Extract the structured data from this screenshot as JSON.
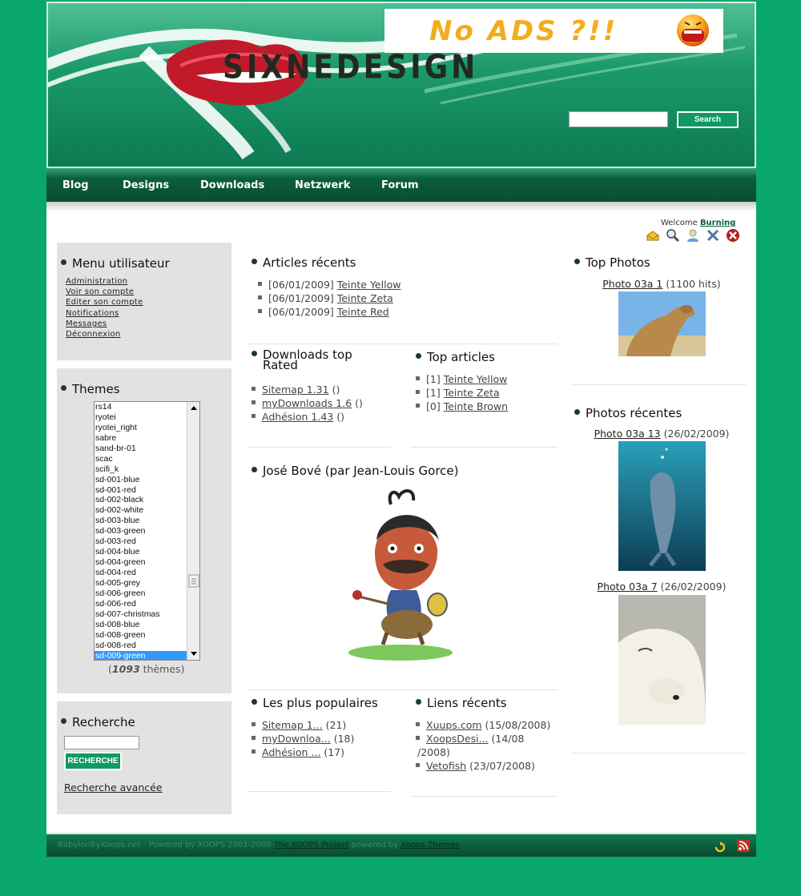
{
  "header": {
    "logo_text": "SIXNEDESIGN",
    "ad_text": "No ADS ?!!",
    "search_placeholder": "",
    "search_button": "Search"
  },
  "nav": {
    "items": [
      "Blog",
      "Designs",
      "Downloads",
      "Netzwerk",
      "Forum"
    ]
  },
  "user": {
    "welcome_label": "Welcome",
    "username": "Burning",
    "icons": [
      "inbox-icon",
      "search-icon",
      "account-icon",
      "tools-icon",
      "logout-icon"
    ]
  },
  "user_menu": {
    "title": "Menu utilisateur",
    "items": [
      "Administration",
      "Voir son compte",
      "Editer son compte",
      "Notifications",
      "Messages",
      "Déconnexion"
    ]
  },
  "themes": {
    "title": "Themes",
    "options": [
      "rs14",
      "ryotei",
      "ryotei_right",
      "sabre",
      "sand-br-01",
      "scac",
      "scifi_k",
      "sd-001-blue",
      "sd-001-red",
      "sd-002-black",
      "sd-002-white",
      "sd-003-blue",
      "sd-003-green",
      "sd-003-red",
      "sd-004-blue",
      "sd-004-green",
      "sd-004-red",
      "sd-005-grey",
      "sd-006-green",
      "sd-006-red",
      "sd-007-christmas",
      "sd-008-blue",
      "sd-008-green",
      "sd-008-red",
      "sd-009-green"
    ],
    "selected": "sd-009-green",
    "count_open": "(",
    "count": "1093",
    "count_suffix": "thèmes)"
  },
  "recherche": {
    "title": "Recherche",
    "input_value": "",
    "button": "Recherche",
    "advanced_link": "Recherche avancée"
  },
  "articles_recents": {
    "title": "Articles récents",
    "items": [
      {
        "date": "[06/01/2009]",
        "link": "Teinte Yellow"
      },
      {
        "date": "[06/01/2009]",
        "link": "Teinte Zeta"
      },
      {
        "date": "[06/01/2009]",
        "link": "Teinte Red"
      }
    ]
  },
  "downloads_top": {
    "title_line1": "Downloads top",
    "title_line2": "Rated",
    "items": [
      {
        "link": "Sitemap 1.31",
        "extra": "()"
      },
      {
        "link": "myDownloads 1.6",
        "extra": "()"
      },
      {
        "link": "Adhésion 1.43",
        "extra": "()"
      }
    ]
  },
  "top_articles": {
    "title": "Top articles",
    "items": [
      {
        "count": "[1]",
        "link": "Teinte Yellow"
      },
      {
        "count": "[1]",
        "link": "Teinte Zeta"
      },
      {
        "count": "[0]",
        "link": "Teinte Brown"
      }
    ]
  },
  "jose_bove": {
    "title": "José Bové (par Jean-Louis Gorce)"
  },
  "populaires": {
    "title": "Les plus populaires",
    "items": [
      {
        "link": "Sitemap 1...",
        "extra": "(21)"
      },
      {
        "link": "myDownloa...",
        "extra": "(18)"
      },
      {
        "link": "Adhésion ...",
        "extra": "(17)"
      }
    ]
  },
  "liens_recents": {
    "title": "Liens récents",
    "items": [
      {
        "link": "Xuups.com",
        "extra": "(15/08/2008)"
      },
      {
        "link": "XoopsDesi...",
        "extra": "(14/08",
        "extra2": "/2008)"
      },
      {
        "link": "Vetofish",
        "extra": "(23/07/2008)"
      }
    ]
  },
  "top_photos": {
    "title": "Top Photos",
    "items": [
      {
        "link": "Photo 03a 1",
        "extra": "(1100 hits)"
      }
    ]
  },
  "photos_recentes": {
    "title": "Photos récentes",
    "items": [
      {
        "link": "Photo 03a 13",
        "extra": "(26/02/2009)"
      },
      {
        "link": "Photo 03a 7",
        "extra": "(26/02/2009)"
      }
    ]
  },
  "footer": {
    "text": "BabylonByXoops.net - Powered by XOOPS 2001-2008",
    "link1": "The XOOPS Project",
    "middle": "powered by",
    "link2": "Xoops Themes"
  },
  "colors": {
    "background": "#0aa76c",
    "nav": "#0a4e32",
    "accent": "#0d9a63",
    "selected": "#3399ff"
  }
}
